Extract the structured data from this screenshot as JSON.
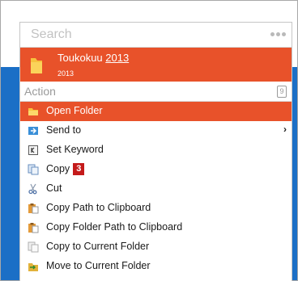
{
  "search": {
    "placeholder": "Search"
  },
  "result": {
    "title_prefix": "Toukokuu ",
    "title_match": "2013",
    "subtitle": "2013"
  },
  "section": {
    "label": "Action",
    "badge": "9"
  },
  "actions": [
    {
      "label": "Open Folder",
      "icon": "folder-open-icon"
    },
    {
      "label": "Send to",
      "icon": "send-to-icon",
      "submenu": true
    },
    {
      "label": "Set Keyword",
      "icon": "keyword-icon"
    },
    {
      "label": "Copy",
      "icon": "copy-icon",
      "badge": "3"
    },
    {
      "label": "Cut",
      "icon": "scissors-icon"
    },
    {
      "label": "Copy Path to Clipboard",
      "icon": "clipboard-icon"
    },
    {
      "label": "Copy Folder Path to Clipboard",
      "icon": "clipboard-icon"
    },
    {
      "label": "Copy to Current Folder",
      "icon": "copy-to-folder-icon"
    },
    {
      "label": "Move to Current Folder",
      "icon": "move-to-folder-icon"
    }
  ],
  "colors": {
    "accent": "#e8522a",
    "background_blue": "#1b6fc6",
    "badge": "#c41a1a"
  }
}
